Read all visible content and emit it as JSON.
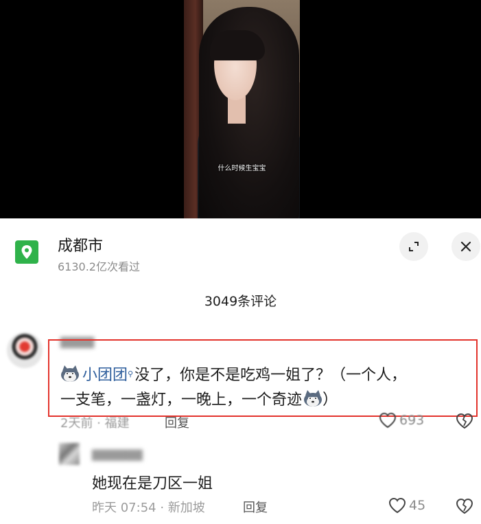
{
  "video": {
    "subtitle": "什么时候生宝宝"
  },
  "location": {
    "title": "成都市",
    "views": "6130.2亿次看过",
    "icon": "location-pin-icon",
    "icon_color": "#2fb24a"
  },
  "comments_header": {
    "count_label": "3049条评论"
  },
  "comment1": {
    "mention": "小团团",
    "text_line1": "没了，你是不是吃鸡一姐了？（一个人，",
    "text_line2": "一支笔，一盏灯，一晚上，一个奇迹",
    "text_line2_end": "）",
    "meta": "2天前 · 福建",
    "reply_label": "回复",
    "like_count": "693",
    "highlight_color": "#e3322b"
  },
  "comment2": {
    "text": "她现在是刀区一姐",
    "meta": "昨天 07:54 · 新加坡",
    "reply_label": "回复",
    "like_count": "45"
  }
}
